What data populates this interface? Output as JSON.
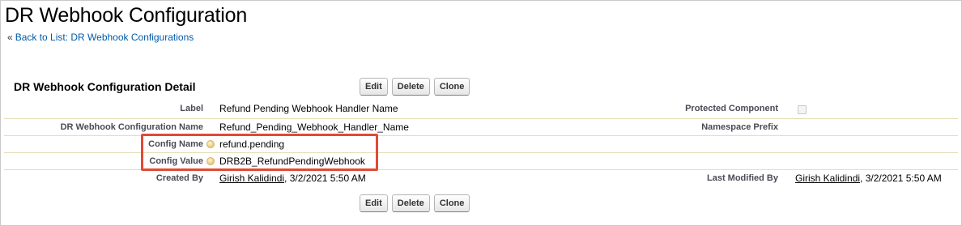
{
  "header": {
    "title": "DR Webhook Configuration",
    "breadcrumb_prefix": "«",
    "breadcrumb_link": "Back to List: DR Webhook Configurations"
  },
  "detail": {
    "section_title": "DR Webhook Configuration Detail",
    "buttons": {
      "edit": "Edit",
      "delete": "Delete",
      "clone": "Clone"
    },
    "fields": {
      "label": {
        "label": "Label",
        "value": "Refund Pending Webhook Handler Name"
      },
      "protected_component": {
        "label": "Protected Component",
        "checked": false
      },
      "config_name_api": {
        "label": "DR Webhook Configuration Name",
        "value": "Refund_Pending_Webhook_Handler_Name"
      },
      "namespace_prefix": {
        "label": "Namespace Prefix",
        "value": ""
      },
      "config_name": {
        "label": "Config Name",
        "value": "refund.pending"
      },
      "config_value": {
        "label": "Config Value",
        "value": "DRB2B_RefundPendingWebhook"
      },
      "created_by": {
        "label": "Created By",
        "user": "Girish Kalidindi",
        "date": ", 3/2/2021 5:50 AM"
      },
      "last_modified_by": {
        "label": "Last Modified By",
        "user": "Girish Kalidindi",
        "date": ", 3/2/2021 5:50 AM"
      }
    }
  },
  "colors": {
    "link": "#015ba7",
    "label": "#4a4a56",
    "divider": "#e3deb8",
    "highlight": "#e04a35"
  },
  "icons": {
    "help": "help-bubble-icon"
  }
}
